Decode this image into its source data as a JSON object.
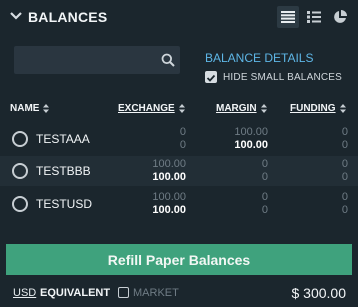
{
  "header": {
    "title": "BALANCES"
  },
  "views": {
    "list": "list-view-icon",
    "detail": "detail-view-icon",
    "pie": "pie-chart-icon"
  },
  "search": {
    "value": "",
    "placeholder": ""
  },
  "details": {
    "link": "BALANCE DETAILS",
    "hide_small_label": "HIDE SMALL BALANCES",
    "hide_small_checked": true
  },
  "columns": {
    "name": "NAME",
    "exchange": "EXCHANGE",
    "margin": "MARGIN",
    "funding": "FUNDING"
  },
  "rows": [
    {
      "name": "TESTAAA",
      "exchange": [
        "0",
        "0"
      ],
      "margin": [
        "100.00",
        "100.00"
      ],
      "funding": [
        "0",
        "0"
      ]
    },
    {
      "name": "TESTBBB",
      "exchange": [
        "100.00",
        "100.00"
      ],
      "margin": [
        "0",
        "0"
      ],
      "funding": [
        "0",
        "0"
      ]
    },
    {
      "name": "TESTUSD",
      "exchange": [
        "100.00",
        "100.00"
      ],
      "margin": [
        "0",
        "0"
      ],
      "funding": [
        "0",
        "0"
      ]
    }
  ],
  "refill_label": "Refill Paper Balances",
  "footer": {
    "currency": "USD",
    "equivalent": "EQUIVALENT",
    "market": "MARKET",
    "total": "$ 300.00"
  },
  "colors": {
    "accent": "#3fa27d",
    "link": "#5eb6e6",
    "background": "#1b262d"
  }
}
